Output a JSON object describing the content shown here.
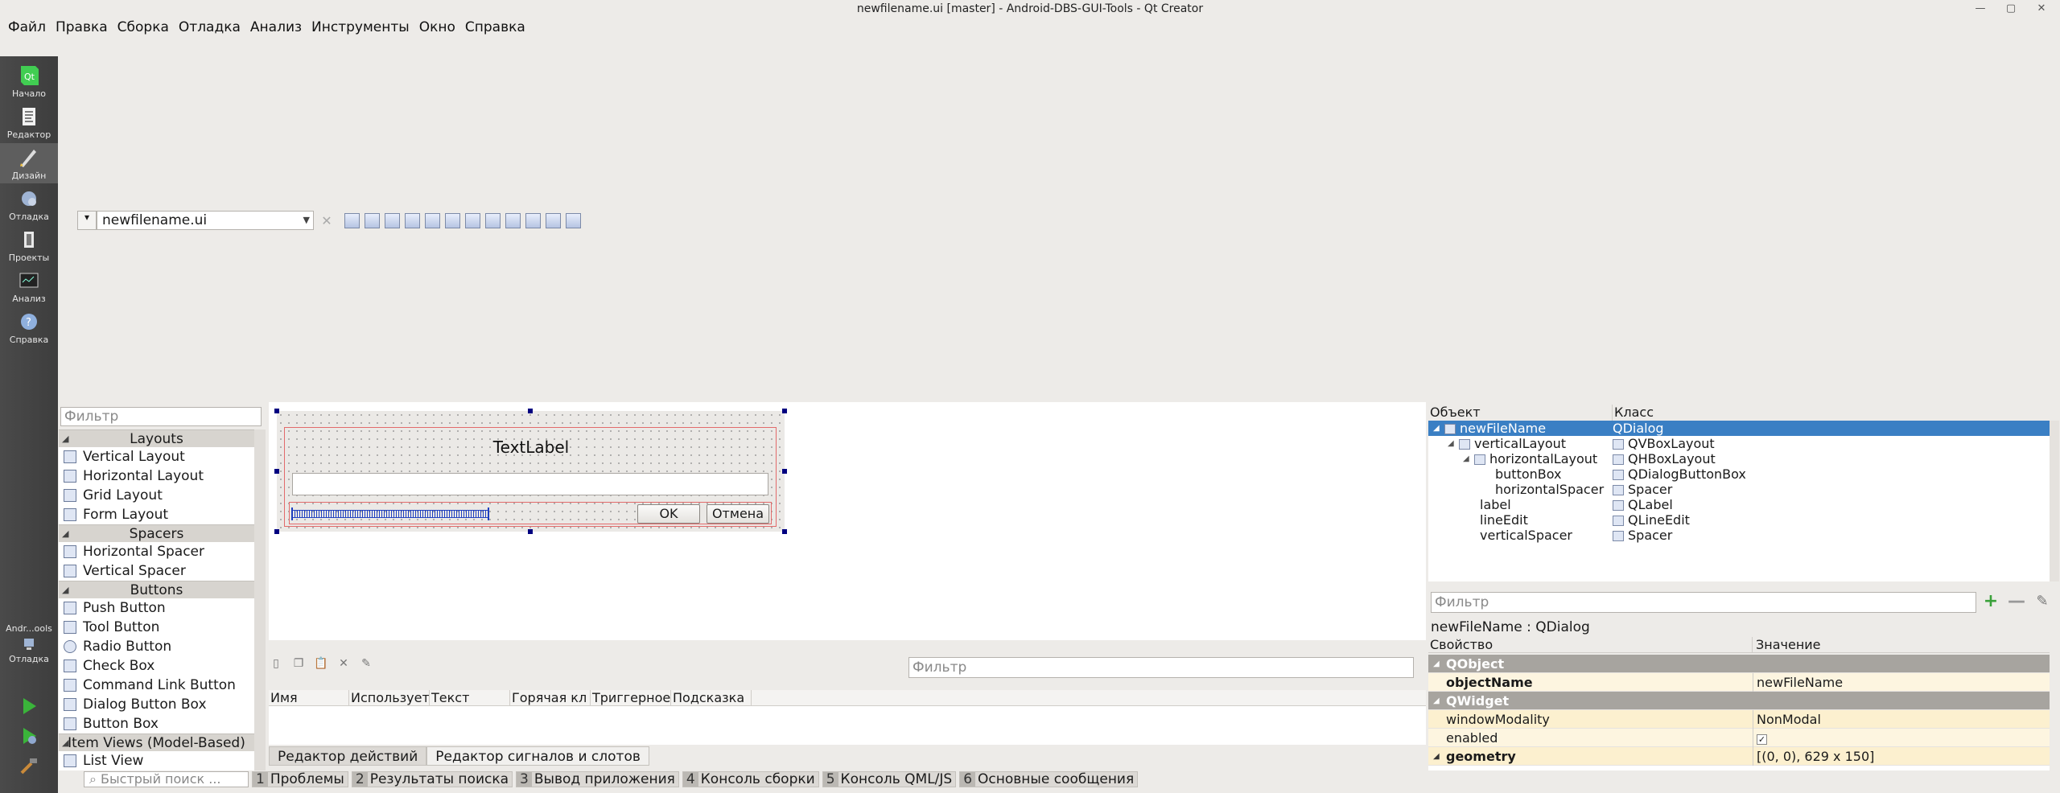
{
  "window": {
    "title": "newfilename.ui [master] - Android-DBS-GUI-Tools - Qt Creator"
  },
  "menubar": [
    "Файл",
    "Правка",
    "Сборка",
    "Отладка",
    "Анализ",
    "Инструменты",
    "Окно",
    "Справка"
  ],
  "modes": [
    {
      "label": "Начало",
      "icon": "qt-logo-icon"
    },
    {
      "label": "Редактор",
      "icon": "editor-icon"
    },
    {
      "label": "Дизайн",
      "icon": "design-icon"
    },
    {
      "label": "Отладка",
      "icon": "debug-icon"
    },
    {
      "label": "Проекты",
      "icon": "projects-icon"
    },
    {
      "label": "Анализ",
      "icon": "analyze-icon"
    },
    {
      "label": "Справка",
      "icon": "help-icon"
    }
  ],
  "kit": {
    "name": "Andr...ools",
    "build": "Отладка"
  },
  "editor": {
    "file": "newfilename.ui"
  },
  "widgetbox": {
    "filter_placeholder": "Фильтр",
    "sections": [
      {
        "title": "Layouts",
        "items": [
          "Vertical Layout",
          "Horizontal Layout",
          "Grid Layout",
          "Form Layout"
        ]
      },
      {
        "title": "Spacers",
        "items": [
          "Horizontal Spacer",
          "Vertical Spacer"
        ]
      },
      {
        "title": "Buttons",
        "items": [
          "Push Button",
          "Tool Button",
          "Radio Button",
          "Check Box",
          "Command Link Button",
          "Dialog Button Box",
          "Button Box"
        ]
      },
      {
        "title": "Item Views (Model-Based)",
        "items": [
          "List View"
        ]
      }
    ]
  },
  "form": {
    "label": "TextLabel",
    "ok": "OK",
    "cancel": "Отмена"
  },
  "actioneditor": {
    "filter_placeholder": "Фильтр",
    "columns": [
      "Имя",
      "Использует",
      "Текст",
      "Горячая кл",
      "Триггерное",
      "Подсказка"
    ],
    "tabs": [
      "Редактор действий",
      "Редактор сигналов и слотов"
    ]
  },
  "inspector": {
    "columns": [
      "Объект",
      "Класс"
    ],
    "rows": [
      {
        "name": "newFileName",
        "class": "QDialog"
      },
      {
        "name": "verticalLayout",
        "class": "QVBoxLayout"
      },
      {
        "name": "horizontalLayout",
        "class": "QHBoxLayout"
      },
      {
        "name": "buttonBox",
        "class": "QDialogButtonBox"
      },
      {
        "name": "horizontalSpacer",
        "class": "Spacer"
      },
      {
        "name": "label",
        "class": "QLabel"
      },
      {
        "name": "lineEdit",
        "class": "QLineEdit"
      },
      {
        "name": "verticalSpacer",
        "class": "Spacer"
      }
    ]
  },
  "properties": {
    "filter_placeholder": "Фильтр",
    "title": "newFileName : QDialog",
    "columns": [
      "Свойство",
      "Значение"
    ],
    "rows": [
      {
        "group": "QObject"
      },
      {
        "name": "objectName",
        "value": "newFileName"
      },
      {
        "group": "QWidget"
      },
      {
        "name": "windowModality",
        "value": "NonModal"
      },
      {
        "name": "enabled",
        "value": "✓"
      },
      {
        "name": "geometry",
        "value": "[(0, 0), 629 x 150]"
      }
    ]
  },
  "statusbar": {
    "quick_placeholder": "Быстрый поиск ...",
    "tabs": [
      {
        "num": "1",
        "label": "Проблемы"
      },
      {
        "num": "2",
        "label": "Результаты поиска"
      },
      {
        "num": "3",
        "label": "Вывод приложения"
      },
      {
        "num": "4",
        "label": "Консоль сборки"
      },
      {
        "num": "5",
        "label": "Консоль QML/JS"
      },
      {
        "num": "6",
        "label": "Основные сообщения"
      }
    ]
  }
}
